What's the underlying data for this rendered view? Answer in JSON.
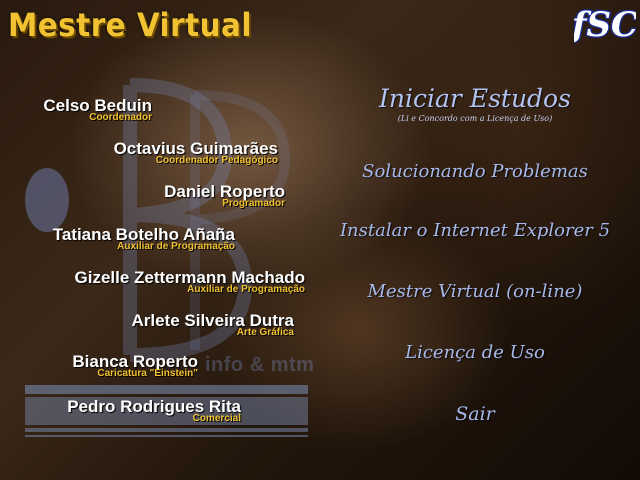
{
  "app": {
    "title": "Mestre Virtual",
    "logo_text": "ƒSC",
    "background_text": "info & mtm"
  },
  "credits": [
    {
      "name": "Celso Beduin",
      "role": "Coordenador"
    },
    {
      "name": "Octavius Guimarães",
      "role": "Coordenador Pedagógico"
    },
    {
      "name": "Daniel Roperto",
      "role": "Programador"
    },
    {
      "name": "Tatiana Botelho Añaña",
      "role": "Auxiliar de Programação"
    },
    {
      "name": "Gizelle Zettermann Machado",
      "role": "Auxiliar de Programação"
    },
    {
      "name": "Arlete Silveira Dutra",
      "role": "Arte Gráfica"
    },
    {
      "name": "Bianca Roperto",
      "role": "Caricatura \"Einstein\""
    },
    {
      "name": "Pedro Rodrigues Rita",
      "role": "Comercial"
    }
  ],
  "menu": {
    "start": {
      "label": "Iniciar Estudos",
      "subtitle": "(Li e Concordo com a Licença de Uso)"
    },
    "items": [
      {
        "label": "Solucionando Problemas"
      },
      {
        "label": "Instalar o Internet Explorer 5"
      },
      {
        "label": "Mestre Virtual (on-line)"
      },
      {
        "label": "Licença de Uso"
      },
      {
        "label": "Sair"
      }
    ]
  },
  "colors": {
    "title": "#f1c232",
    "menu_text": "#a7b8ea",
    "credit_name": "#ffffff",
    "credit_role": "#f1c232",
    "logo": "#1a2f9e"
  }
}
